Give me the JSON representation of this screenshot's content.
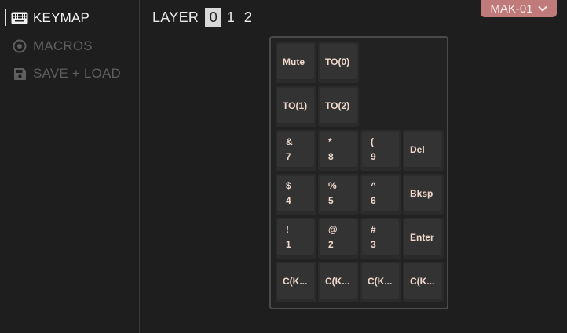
{
  "sidebar": {
    "items": [
      {
        "label": "KEYMAP",
        "icon": "keyboard-icon",
        "active": true
      },
      {
        "label": "MACROS",
        "icon": "record-icon",
        "active": false
      },
      {
        "label": "SAVE + LOAD",
        "icon": "floppy-disk-icon",
        "active": false
      }
    ]
  },
  "layers": {
    "label": "LAYER",
    "options": [
      "0",
      "1",
      "2"
    ],
    "selected": "0"
  },
  "device": {
    "name": "MAK-01"
  },
  "keymap": {
    "rows": [
      [
        {
          "label": "Mute"
        },
        {
          "label": "TO(0)"
        }
      ],
      [
        {
          "label": "TO(1)"
        },
        {
          "label": "TO(2)"
        }
      ],
      [
        {
          "top": "&",
          "bottom": "7"
        },
        {
          "top": "*",
          "bottom": "8"
        },
        {
          "top": "(",
          "bottom": "9"
        },
        {
          "label": "Del"
        }
      ],
      [
        {
          "top": "$",
          "bottom": "4"
        },
        {
          "top": "%",
          "bottom": "5"
        },
        {
          "top": "^",
          "bottom": "6"
        },
        {
          "label": "Bksp"
        }
      ],
      [
        {
          "top": "!",
          "bottom": "1"
        },
        {
          "top": "@",
          "bottom": "2"
        },
        {
          "top": "#",
          "bottom": "3"
        },
        {
          "label": "Enter"
        }
      ],
      [
        {
          "label": "C(K..."
        },
        {
          "label": "C(K..."
        },
        {
          "label": "C(K..."
        },
        {
          "label": "C(K..."
        }
      ]
    ]
  },
  "colors": {
    "background": "#1e1e1e",
    "accent": "#c07a7a",
    "key_text": "#f0d8cc"
  }
}
